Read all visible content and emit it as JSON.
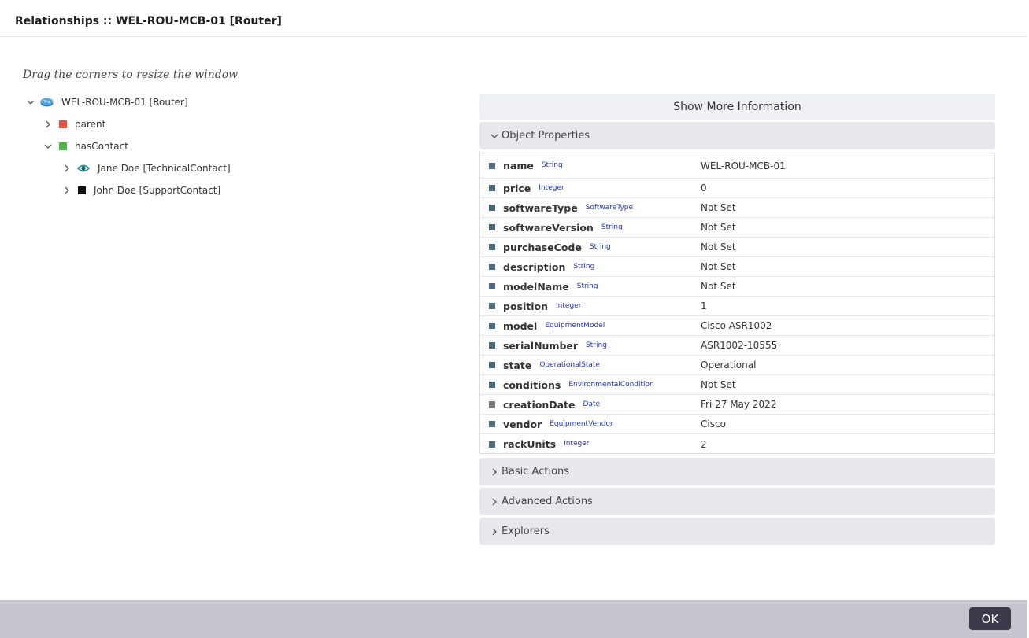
{
  "dialog": {
    "title": "Relationships :: WEL-ROU-MCB-01 [Router]",
    "hint": "Drag the corners to resize the window",
    "ok_label": "OK"
  },
  "tree": {
    "root": {
      "label": "WEL-ROU-MCB-01 [Router]",
      "icon": "router-icon"
    },
    "parent": {
      "label": "parent",
      "color": "#e5503f"
    },
    "hasContact": {
      "label": "hasContact",
      "color": "#4cb844"
    },
    "jane": {
      "label": "Jane Doe [TechnicalContact]",
      "icon": "eye-icon"
    },
    "john": {
      "label": "John Doe [SupportContact]",
      "color": "#111111"
    }
  },
  "panel": {
    "show_more": "Show More Information",
    "object_properties": "Object Properties",
    "basic_actions": "Basic Actions",
    "advanced_actions": "Advanced Actions",
    "explorers": "Explorers"
  },
  "properties": [
    {
      "name": "name",
      "type": "String",
      "value": "WEL-ROU-MCB-01"
    },
    {
      "name": "price",
      "type": "Integer",
      "value": "0"
    },
    {
      "name": "softwareType",
      "type": "SoftwareType",
      "value": "Not Set"
    },
    {
      "name": "softwareVersion",
      "type": "String",
      "value": "Not Set"
    },
    {
      "name": "purchaseCode",
      "type": "String",
      "value": "Not Set"
    },
    {
      "name": "description",
      "type": "String",
      "value": "Not Set"
    },
    {
      "name": "modelName",
      "type": "String",
      "value": "Not Set"
    },
    {
      "name": "position",
      "type": "Integer",
      "value": "1"
    },
    {
      "name": "model",
      "type": "EquipmentModel",
      "value": "Cisco ASR1002"
    },
    {
      "name": "serialNumber",
      "type": "String",
      "value": "ASR1002-10555"
    },
    {
      "name": "state",
      "type": "OperationalState",
      "value": "Operational"
    },
    {
      "name": "conditions",
      "type": "EnvironmentalCondition",
      "value": "Not Set"
    },
    {
      "name": "creationDate",
      "type": "Date",
      "value": "Fri 27 May 2022"
    },
    {
      "name": "vendor",
      "type": "EquipmentVendor",
      "value": "Cisco"
    },
    {
      "name": "rackUnits",
      "type": "Integer",
      "value": "2"
    }
  ]
}
